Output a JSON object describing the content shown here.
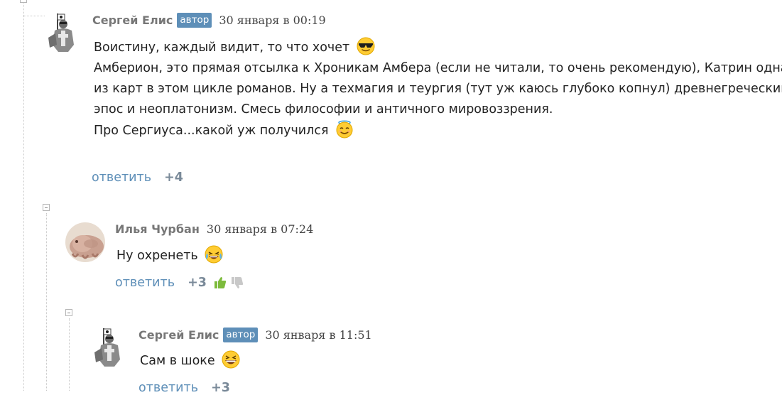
{
  "comments": [
    {
      "author": "Сергей Елис",
      "badge": "автор",
      "date": "30 января в 00:19",
      "lines": [
        "Воистину, каждый видит, то что хочет",
        "Амберион, это прямая отсылка к Хроникам Амбера (если не читали, то очень рекомендую), Катрин одна",
        "из карт в этом цикле романов. Ну а техмагия и теургия (тут уж каюсь глубоко копнул) древнегреческий",
        "эпос и неоплатонизм. Смесь философии и античного мировоззрения.",
        "Про Сергиуса...какой уж получился"
      ],
      "reply_label": "ответить",
      "score": "+4"
    },
    {
      "author": "Илья Чурбан",
      "date": "30 января в 07:24",
      "lines": [
        "Ну охренеть"
      ],
      "reply_label": "ответить",
      "score": "+3"
    },
    {
      "author": "Сергей Елис",
      "badge": "автор",
      "date": "30 января в 11:51",
      "lines": [
        "Сам в шоке"
      ],
      "reply_label": "ответить",
      "score": "+3"
    }
  ],
  "icons": {
    "emoji_1": "sunglasses-emoji-icon",
    "emoji_2": "halo-emoji-icon",
    "emoji_3": "tears-of-joy-emoji-icon",
    "emoji_4": "grinning-squinting-emoji-icon",
    "vote_up": "thumb-up-icon",
    "vote_down": "thumb-down-icon",
    "collapse": "collapse-minus-icon"
  },
  "colors": {
    "link": "#5e8fb8",
    "badge_bg": "#5e8fb8",
    "author": "#777777",
    "score": "#7a8a99",
    "thumb_up": "#7dbb3c",
    "thumb_down": "#c8c8c8"
  }
}
